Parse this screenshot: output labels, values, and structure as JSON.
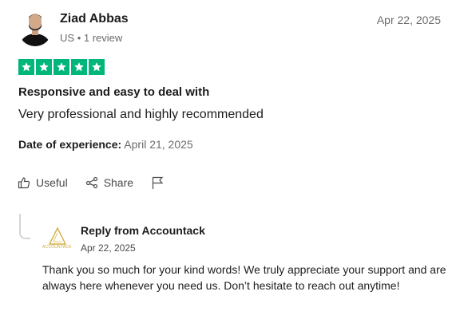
{
  "reviewer": {
    "name": "Ziad Abbas",
    "country": "US",
    "review_count": "1 review",
    "meta_separator": "•"
  },
  "review": {
    "date": "Apr 22, 2025",
    "rating": 5,
    "rating_max": 5,
    "star_color": "#00b67a",
    "title": "Responsive and easy to deal with",
    "body": "Very professional and highly recommended",
    "experience_label": "Date of experience:",
    "experience_date": "April 21, 2025"
  },
  "actions": {
    "useful_label": "Useful",
    "share_label": "Share",
    "icons": [
      "thumbs-up-icon",
      "share-icon",
      "flag-icon"
    ]
  },
  "reply": {
    "from": "Reply from Accountack",
    "date": "Apr 22, 2025",
    "logo_text": "ACCOUNTACK",
    "text": "Thank you so much for your kind words! We truly appreciate your support and are always here whenever you need us. Don’t hesitate to reach out anytime!"
  }
}
